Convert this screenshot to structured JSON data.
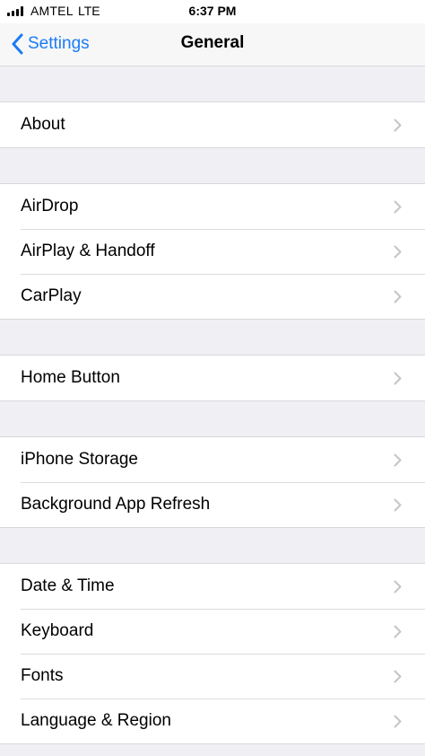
{
  "status_bar": {
    "carrier": "AMTEL",
    "network": "LTE",
    "time": "6:37 PM"
  },
  "nav": {
    "back_label": "Settings",
    "title": "General"
  },
  "groups": [
    {
      "rows": [
        {
          "label": "About"
        }
      ]
    },
    {
      "rows": [
        {
          "label": "AirDrop"
        },
        {
          "label": "AirPlay & Handoff"
        },
        {
          "label": "CarPlay"
        }
      ]
    },
    {
      "rows": [
        {
          "label": "Home Button"
        }
      ]
    },
    {
      "rows": [
        {
          "label": "iPhone Storage"
        },
        {
          "label": "Background App Refresh"
        }
      ]
    },
    {
      "rows": [
        {
          "label": "Date & Time"
        },
        {
          "label": "Keyboard"
        },
        {
          "label": "Fonts"
        },
        {
          "label": "Language & Region"
        }
      ]
    }
  ],
  "icons": {
    "signal": "cellular-signal-icon",
    "back": "chevron-left-icon",
    "row_disclosure": "chevron-right-icon"
  },
  "colors": {
    "accent": "#1a7cf5",
    "grouped_background": "#efeff4",
    "separator": "#d8d8dc",
    "chevron": "#c4c4c9"
  }
}
